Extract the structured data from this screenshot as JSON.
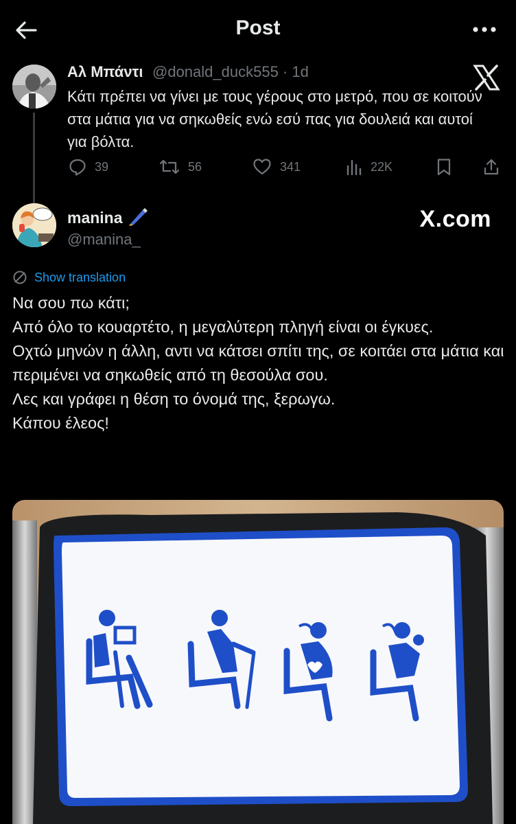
{
  "header": {
    "title": "Post",
    "back_icon": "arrow-left-icon",
    "more_icon": "more-horizontal-icon"
  },
  "parent_tweet": {
    "display_name": "Αλ Μπάντι",
    "handle": "@donald_duck555 · 1d",
    "text": "Κάτι πρέπει να γίνει με τους γέρους στο μετρό, που σε κοιτούν στα μάτια για να σηκωθείς ενώ εσύ πας για δουλειά και αυτοί για βόλτα.",
    "replies": "39",
    "reposts": "56",
    "likes": "341",
    "views": "22K"
  },
  "main_tweet": {
    "display_name": "manina",
    "handle": "@manina_",
    "watermark": "X.com",
    "translate_label": "Show translation",
    "lines": [
      "Να σου πω κάτι;",
      "Από όλο το κουαρτέτο, η μεγαλύτερη πληγή είναι οι έγκυες.",
      "Οχτώ μηνών η άλλη, αντι να κάτσει σπίτι της, σε κοιτάει στα μάτια και περιμένει να σηκωθείς από τη θεσούλα σου.",
      "Λες και γράφει η θέση το όνομά της, ξερωγω.",
      "Κάπου έλεος!"
    ]
  },
  "colors": {
    "background": "#000000",
    "text": "#e7e9ea",
    "muted": "#71767b",
    "link": "#1d9bf0",
    "sign_blue": "#1f4fc8"
  }
}
